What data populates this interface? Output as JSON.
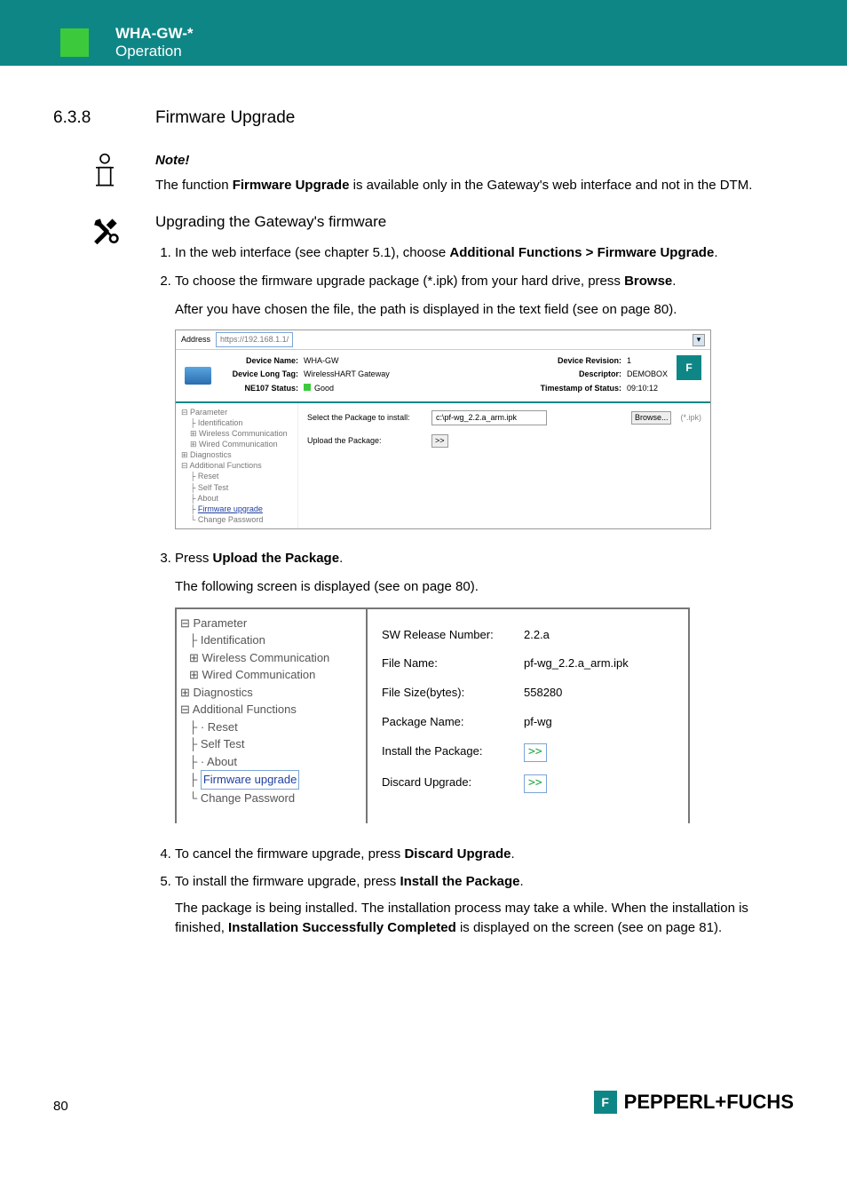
{
  "header": {
    "model": "WHA-GW-*",
    "section": "Operation"
  },
  "section": {
    "number": "6.3.8",
    "title": "Firmware Upgrade"
  },
  "note": {
    "title": "Note!",
    "text_a": "The function ",
    "text_b": "Firmware Upgrade",
    "text_c": " is available only in the Gateway's web interface and not in the DTM."
  },
  "procedure": {
    "heading": "Upgrading the Gateway's firmware",
    "step1_a": "In the web interface (see chapter 5.1), choose ",
    "step1_b": "Additional Functions > Firmware Upgrade",
    "step1_c": ".",
    "step2_a": "To choose the firmware upgrade package (*.ipk) from your hard drive, press ",
    "step2_b": "Browse",
    "step2_c": ".",
    "step2_follow": "After you have chosen the file, the path is displayed in the text field (see  on page 80).",
    "step3_a": "Press ",
    "step3_b": "Upload the Package",
    "step3_c": ".",
    "step3_follow": "The following screen is displayed (see  on page 80).",
    "step4_a": "To cancel the firmware upgrade, press ",
    "step4_b": "Discard Upgrade",
    "step4_c": ".",
    "step5_a": "To install the firmware upgrade, press ",
    "step5_b": "Install the Package",
    "step5_c": ".",
    "step5_follow_a": "The package is being installed. The installation process may take a while. When the installation is finished, ",
    "step5_follow_b": "Installation Successfully Completed",
    "step5_follow_c": " is displayed on the screen (see  on page 81)."
  },
  "shot1": {
    "address_label": "Address",
    "url": "https://192.168.1.1/",
    "dn_k": "Device Name:",
    "dn_v": "WHA-GW",
    "dlt_k": "Device Long Tag:",
    "dlt_v": "WirelessHART Gateway",
    "ns_k": "NE107 Status:",
    "ns_v": "Good",
    "dr_k": "Device Revision:",
    "dr_v": "1",
    "ds_k": "Descriptor:",
    "ds_v": "DEMOBOX",
    "ts_k": "Timestamp of Status:",
    "ts_v": "09:10:12",
    "tree": {
      "parameter": "Parameter",
      "identification": "Identification",
      "wireless": "Wireless Communication",
      "wired": "Wired Communication",
      "diagnostics": "Diagnostics",
      "additional": "Additional Functions",
      "reset": "Reset",
      "selftest": "Self Test",
      "about": "About",
      "firmware": "Firmware upgrade",
      "changepw": "Change Password"
    },
    "select_label": "Select the Package to install:",
    "select_value": "c:\\pf-wg_2.2.a_arm.ipk",
    "browse": "Browse...",
    "ext": "(*.ipk)",
    "upload_label": "Upload the Package:",
    "upload_btn": ">>"
  },
  "shot2": {
    "tree": {
      "parameter": "Parameter",
      "identification": "Identification",
      "wireless": "Wireless Communication",
      "wired": "Wired Communication",
      "diagnostics": "Diagnostics",
      "additional": "Additional Functions",
      "reset": "Reset",
      "selftest": "Self Test",
      "about": "About",
      "firmware": "Firmware upgrade",
      "changepw": "Change Password"
    },
    "sw_k": "SW Release Number:",
    "sw_v": "2.2.a",
    "fn_k": "File Name:",
    "fn_v": "pf-wg_2.2.a_arm.ipk",
    "fs_k": "File Size(bytes):",
    "fs_v": "558280",
    "pn_k": "Package Name:",
    "pn_v": "pf-wg",
    "ip_k": "Install the Package:",
    "ip_v": ">>",
    "du_k": "Discard Upgrade:",
    "du_v": ">>"
  },
  "footer": {
    "page": "80",
    "brand": "PEPPERL+FUCHS"
  }
}
